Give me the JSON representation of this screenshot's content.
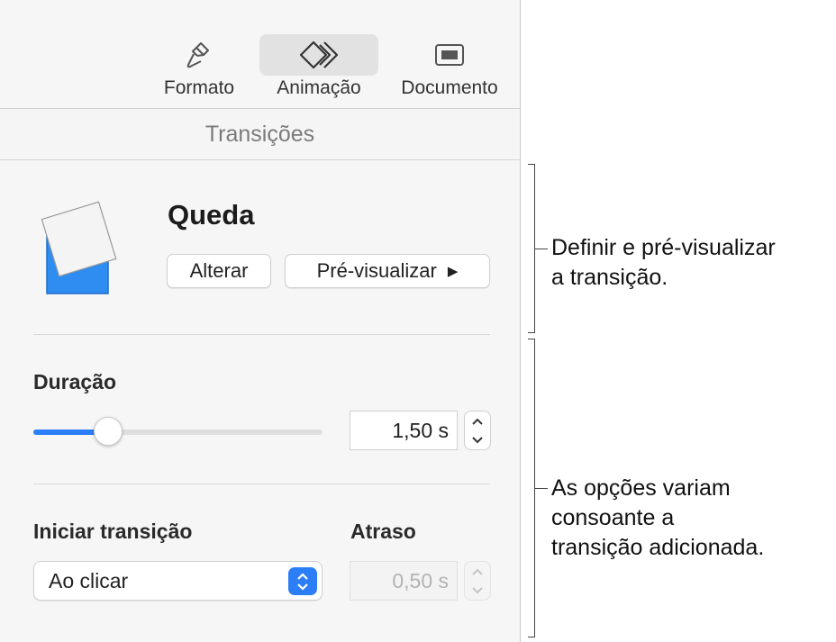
{
  "toolbar": {
    "tabs": [
      {
        "label": "Formato",
        "icon": "paintbrush-icon",
        "active": false
      },
      {
        "label": "Animação",
        "icon": "diamond-animation-icon",
        "active": true
      },
      {
        "label": "Documento",
        "icon": "document-icon",
        "active": false
      }
    ]
  },
  "section_tab": {
    "label": "Transições"
  },
  "transition": {
    "name": "Queda",
    "change_button": "Alterar",
    "preview_button": "Pré-visualizar",
    "thumbnail_color": "#2f8cf0"
  },
  "duration": {
    "label": "Duração",
    "value": "1,50 s",
    "slider_fraction": 0.26
  },
  "start": {
    "label": "Iniciar transição",
    "selected": "Ao clicar"
  },
  "delay": {
    "label": "Atraso",
    "value": "0,50 s",
    "disabled": true
  },
  "callouts": [
    {
      "lines": [
        "Definir e pré-visualizar",
        "a transição."
      ]
    },
    {
      "lines": [
        "As opções variam",
        "consoante a",
        "transição adicionada."
      ]
    }
  ],
  "colors": {
    "accent": "#2b7ef6",
    "panel_bg": "#f6f6f6"
  }
}
